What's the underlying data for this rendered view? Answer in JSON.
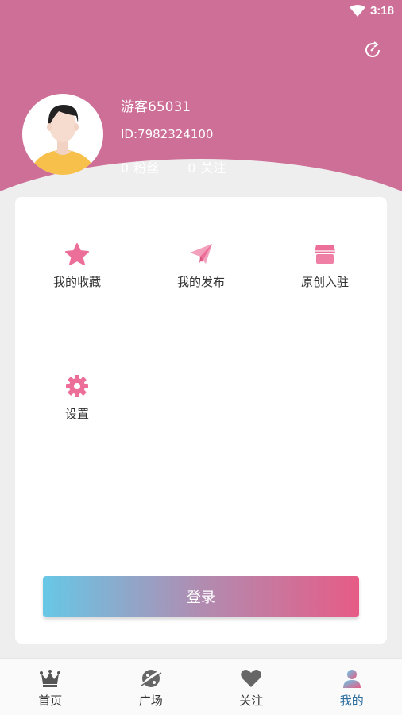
{
  "status_bar": {
    "time": "3:18"
  },
  "profile": {
    "name": "游客65031",
    "id": "ID:7982324100",
    "fans_count": "0",
    "fans_label": "粉丝",
    "following_count": "0",
    "following_label": "关注"
  },
  "menu": {
    "items": [
      {
        "label": "我的收藏",
        "icon": "star-icon"
      },
      {
        "label": "我的发布",
        "icon": "paper-plane-icon"
      },
      {
        "label": "原创入驻",
        "icon": "store-icon"
      },
      {
        "label": "设置",
        "icon": "gear-icon"
      }
    ]
  },
  "login_label": "登录",
  "bottom_nav": {
    "items": [
      {
        "label": "首页",
        "icon": "crown-icon"
      },
      {
        "label": "广场",
        "icon": "planet-icon"
      },
      {
        "label": "关注",
        "icon": "heart-icon"
      },
      {
        "label": "我的",
        "icon": "user-icon"
      }
    ],
    "active_index": 3
  },
  "colors": {
    "header": "#cd6f97",
    "accent_pink": "#ec6f9a",
    "gradient_start": "#67c7e6",
    "gradient_end": "#e65c86",
    "nav_active": "#2f6fa0"
  }
}
